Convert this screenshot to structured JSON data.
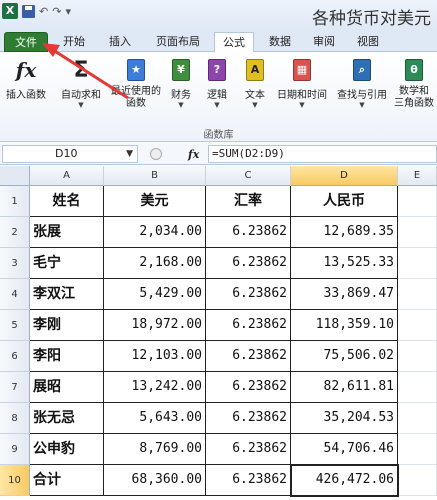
{
  "titlebar": {
    "app_icon_letter": "X",
    "undo_glyph": "↶",
    "redo_glyph": "↷",
    "qat_menu_glyph": "▾",
    "title": "各种货币对美元"
  },
  "tabs": [
    {
      "label": "文件",
      "key": "file"
    },
    {
      "label": "开始",
      "key": "home"
    },
    {
      "label": "插入",
      "key": "insert"
    },
    {
      "label": "页面布局",
      "key": "layout"
    },
    {
      "label": "公式",
      "key": "formulas"
    },
    {
      "label": "数据",
      "key": "data"
    },
    {
      "label": "审阅",
      "key": "review"
    },
    {
      "label": "视图",
      "key": "view"
    }
  ],
  "ribbon": {
    "insert_function": {
      "glyph": "fx",
      "label": "插入函数"
    },
    "autosum": {
      "glyph": "Σ",
      "label": "自动求和"
    },
    "recent": {
      "line1": "最近使用的",
      "line2": "函数"
    },
    "financial": {
      "label": "财务",
      "color": "#3f8f3f"
    },
    "logical": {
      "label": "逻辑",
      "color": "#8e44ad",
      "glyph": "?"
    },
    "text": {
      "label": "文本",
      "color": "#d4b106",
      "glyph": "A"
    },
    "datetime": {
      "label": "日期和时间",
      "color": "#d9534f"
    },
    "lookup": {
      "label": "查找与引用",
      "color": "#2f6fb6"
    },
    "math": {
      "line1": "数学和",
      "line2": "三角函数",
      "color": "#2e8b57",
      "glyph": "θ"
    },
    "group_label": "函数库"
  },
  "formula_bar": {
    "name_box": "D10",
    "fx_label": "fx",
    "formula": "=SUM(D2:D9)"
  },
  "grid": {
    "columns": [
      "A",
      "B",
      "C",
      "D",
      "E"
    ],
    "row_numbers": [
      "1",
      "2",
      "3",
      "4",
      "5",
      "6",
      "7",
      "8",
      "9",
      "10"
    ],
    "header": [
      "姓名",
      "美元",
      "汇率",
      "人民币"
    ],
    "rows": [
      [
        "张展",
        "2,034.00",
        "6.23862",
        "12,689.35"
      ],
      [
        "毛宁",
        "2,168.00",
        "6.23862",
        "13,525.33"
      ],
      [
        "李双江",
        "5,429.00",
        "6.23862",
        "33,869.47"
      ],
      [
        "李刚",
        "18,972.00",
        "6.23862",
        "118,359.10"
      ],
      [
        "李阳",
        "12,103.00",
        "6.23862",
        "75,506.02"
      ],
      [
        "展昭",
        "13,242.00",
        "6.23862",
        "82,611.81"
      ],
      [
        "张无忌",
        "5,643.00",
        "6.23862",
        "35,204.53"
      ],
      [
        "公申豹",
        "8,769.00",
        "6.23862",
        "54,706.46"
      ],
      [
        "合计",
        "68,360.00",
        "6.23862",
        "426,472.06"
      ]
    ],
    "active_cell": "D10"
  },
  "colors": {
    "file_tab": "#2e7d32",
    "arrow": "#e53935",
    "selected_header": "#f8c962"
  }
}
